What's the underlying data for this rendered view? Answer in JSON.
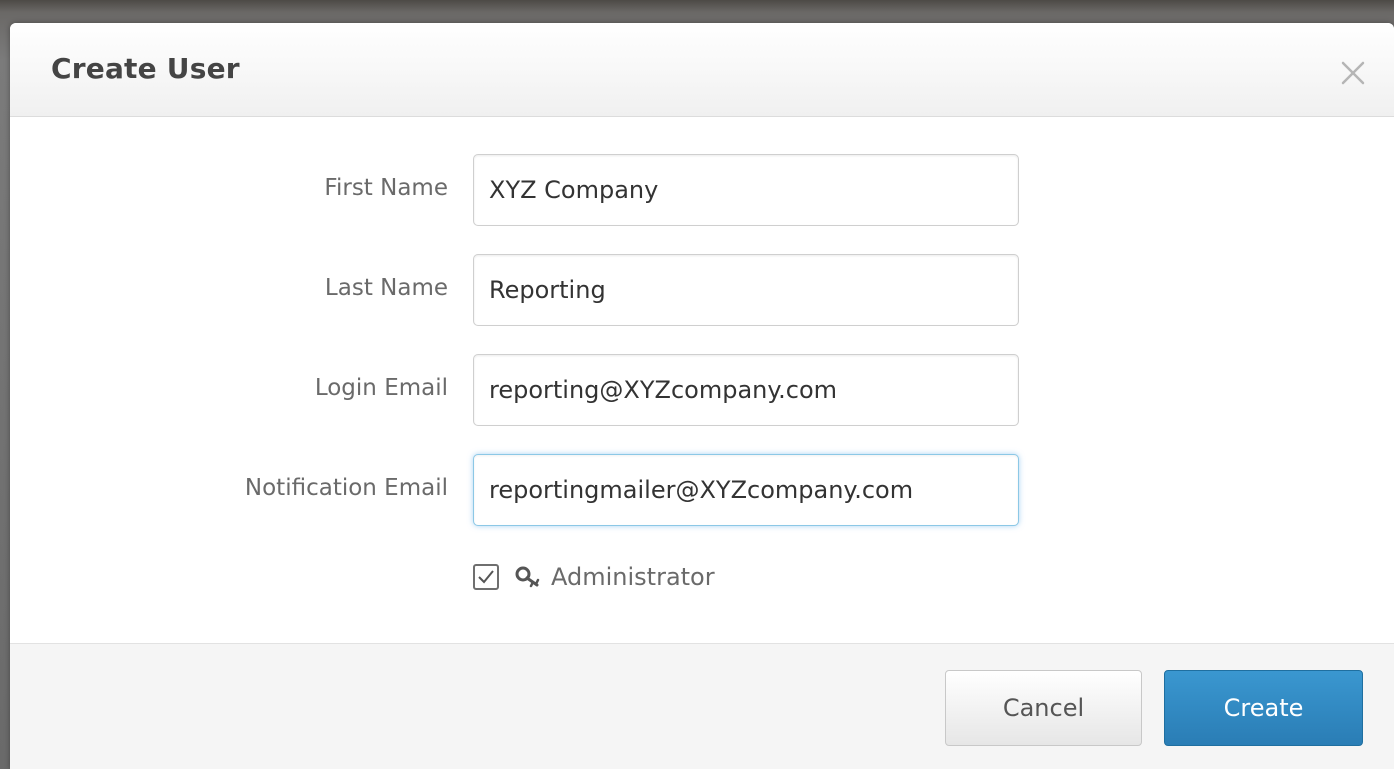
{
  "dialog": {
    "title": "Create User",
    "close_icon": "close-icon"
  },
  "form": {
    "fields": [
      {
        "label": "First Name",
        "value": "XYZ Company"
      },
      {
        "label": "Last Name",
        "value": "Reporting"
      },
      {
        "label": "Login Email",
        "value": "reporting@XYZcompany.com"
      },
      {
        "label": "Notification Email",
        "value": "reportingmailer@XYZcompany.com"
      }
    ],
    "administrator": {
      "label": "Administrator",
      "checked": true,
      "icon": "key-icon"
    }
  },
  "footer": {
    "cancel_label": "Cancel",
    "create_label": "Create"
  },
  "colors": {
    "primary_button": "#2f87c0",
    "focus_border": "#8cc8e6"
  }
}
